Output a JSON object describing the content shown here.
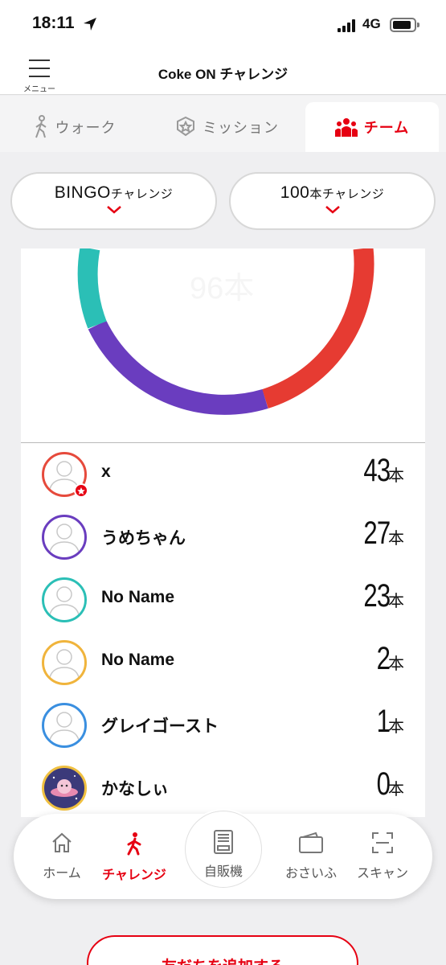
{
  "status_bar": {
    "time": "18:11",
    "network": "4G"
  },
  "header": {
    "menu_label": "メニュー",
    "title": "Coke ON チャレンジ"
  },
  "tabs": [
    {
      "label": "ウォーク",
      "icon": "walk-icon",
      "active": false
    },
    {
      "label": "ミッション",
      "icon": "badge-icon",
      "active": false
    },
    {
      "label": "チーム",
      "icon": "team-icon",
      "active": true
    }
  ],
  "toggles": {
    "bingo": {
      "strong": "BINGO",
      "small": "チャレンジ"
    },
    "hundred": {
      "strong": "100",
      "small": "本チャレンジ"
    }
  },
  "ring": {
    "center_text": "96本",
    "colors": [
      "#e63b32",
      "#6a3dbf",
      "#2bbfb6"
    ]
  },
  "members": [
    {
      "name": "x",
      "count": "43",
      "unit": "本",
      "ring_color": "#e64a3c",
      "badge": true
    },
    {
      "name": "うめちゃん",
      "count": "27",
      "unit": "本",
      "ring_color": "#6a3dbf",
      "badge": false
    },
    {
      "name": "No Name",
      "count": "23",
      "unit": "本",
      "ring_color": "#2bbfb6",
      "badge": false
    },
    {
      "name": "No Name",
      "count": "2",
      "unit": "本",
      "ring_color": "#f0b43c",
      "badge": false
    },
    {
      "name": "グレイゴースト",
      "count": "1",
      "unit": "本",
      "ring_color": "#3a8fe0",
      "badge": false
    },
    {
      "name": "かなしぃ",
      "count": "0",
      "unit": "本",
      "ring_color": "#f0c040",
      "badge": false
    }
  ],
  "bottom_nav": {
    "home": "ホーム",
    "challenge": "チャレンジ",
    "vending": "自販機",
    "wallet": "おさいふ",
    "scan": "スキャン"
  },
  "add_friend_button": "友だちを追加する",
  "colors": {
    "accent": "#e60012"
  }
}
